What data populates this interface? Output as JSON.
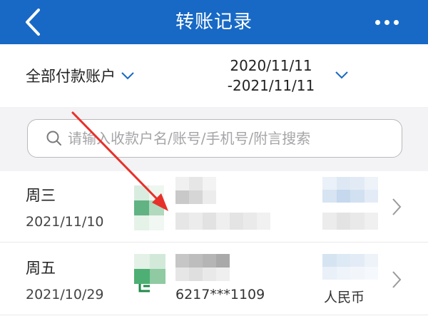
{
  "header": {
    "title": "转账记录",
    "back_icon": "chevron-left-icon",
    "more_icon": "more-horizontal-icon",
    "background": "#1769c5"
  },
  "filter": {
    "account_label": "全部付款账户",
    "date_start": "2020/11/11",
    "date_end": "-2021/11/11",
    "chevron_color": "#1769c5"
  },
  "search": {
    "placeholder": "请输入收款户名/账号/手机号/附言搜索"
  },
  "records": [
    {
      "weekday": "周三",
      "date": "2021/11/10",
      "account": "",
      "currency": ""
    },
    {
      "weekday": "周五",
      "date": "2021/10/29",
      "account": "6217***1109",
      "currency": "人民币"
    }
  ],
  "annotation": {
    "arrow_color": "#e8302a"
  }
}
